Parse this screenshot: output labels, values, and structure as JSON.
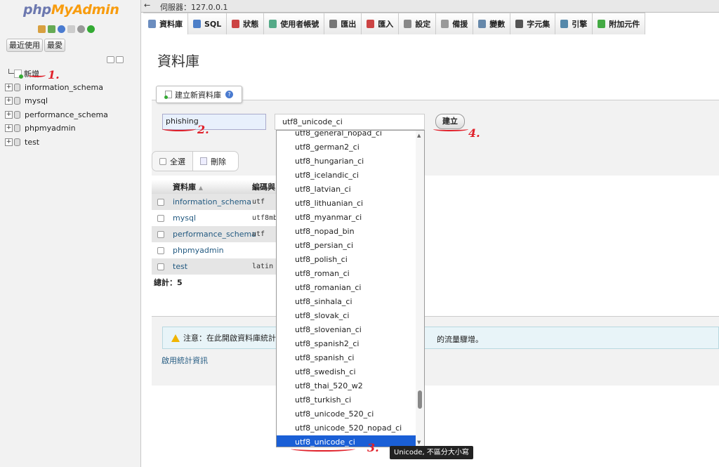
{
  "app": {
    "logo_part1": "php",
    "logo_part2": "MyAdmin"
  },
  "sidebar": {
    "recent_btn": "最近使用",
    "fav_btn": "最愛",
    "new_label": "新增",
    "databases": [
      "information_schema",
      "mysql",
      "performance_schema",
      "phpmyadmin",
      "test"
    ]
  },
  "topbar": {
    "back": "←",
    "server": "伺服器：127.0.0.1"
  },
  "tabs": [
    {
      "label": "資料庫",
      "color": "#6b8dbf"
    },
    {
      "label": "SQL",
      "color": "#4d7fc8"
    },
    {
      "label": "狀態",
      "color": "#c44"
    },
    {
      "label": "使用者帳號",
      "color": "#5a8"
    },
    {
      "label": "匯出",
      "color": "#777"
    },
    {
      "label": "匯入",
      "color": "#c44"
    },
    {
      "label": "設定",
      "color": "#888"
    },
    {
      "label": "備援",
      "color": "#999"
    },
    {
      "label": "變數",
      "color": "#68a"
    },
    {
      "label": "字元集",
      "color": "#555"
    },
    {
      "label": "引擎",
      "color": "#58a"
    },
    {
      "label": "附加元件",
      "color": "#4a4"
    }
  ],
  "main": {
    "title": "資料庫",
    "create_legend": "建立新資料庫",
    "dbname_value": "phishing",
    "collation_value": "utf8_unicode_ci",
    "create_button": "建立",
    "select_all": "全選",
    "delete": "刪除",
    "table_headers": {
      "database": "資料庫",
      "collation": "編碼與"
    },
    "rows": [
      {
        "name": "information_schema",
        "collation": "utf"
      },
      {
        "name": "mysql",
        "collation": "utf8mb"
      },
      {
        "name": "performance_schema",
        "collation": "utf"
      },
      {
        "name": "phpmyadmin",
        "collation": ""
      },
      {
        "name": "test",
        "collation": "latin"
      }
    ],
    "total": "總計：5",
    "notice_head": "注意：在此開啟資料庫統計",
    "notice_tail": "的流量驟增。",
    "stats_link": "啟用統計資訊"
  },
  "dropdown": {
    "options": [
      "utf8_general_nopad_ci",
      "utf8_german2_ci",
      "utf8_hungarian_ci",
      "utf8_icelandic_ci",
      "utf8_latvian_ci",
      "utf8_lithuanian_ci",
      "utf8_myanmar_ci",
      "utf8_nopad_bin",
      "utf8_persian_ci",
      "utf8_polish_ci",
      "utf8_roman_ci",
      "utf8_romanian_ci",
      "utf8_sinhala_ci",
      "utf8_slovak_ci",
      "utf8_slovenian_ci",
      "utf8_spanish2_ci",
      "utf8_spanish_ci",
      "utf8_swedish_ci",
      "utf8_thai_520_w2",
      "utf8_turkish_ci",
      "utf8_unicode_520_ci",
      "utf8_unicode_520_nopad_ci",
      "utf8_unicode_ci"
    ],
    "selected": "utf8_unicode_ci",
    "tooltip": "Unicode, 不區分大小寫"
  },
  "annotations": {
    "a1": "1.",
    "a2": "2.",
    "a3": "3.",
    "a4": "4.",
    "color": "#e0202a"
  }
}
